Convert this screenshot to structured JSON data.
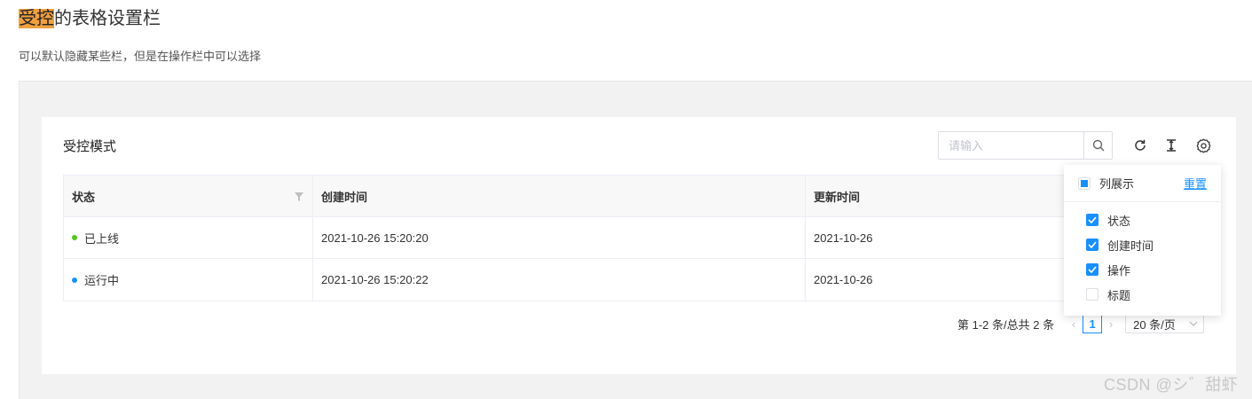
{
  "page": {
    "title_highlight": "受控",
    "title_rest": "的表格设置栏",
    "description": "可以默认隐藏某些栏，但是在操作栏中可以选择"
  },
  "card": {
    "title": "受控模式",
    "search_placeholder": "请输入",
    "icons": [
      "reload-icon",
      "column-height-icon",
      "setting-icon"
    ]
  },
  "table": {
    "headers": [
      "状态",
      "创建时间",
      "更新时间"
    ],
    "rows": [
      {
        "status": "已上线",
        "status_color": "#52c41a",
        "created": "2021-10-26 15:20:20",
        "updated": "2021-10-26"
      },
      {
        "status": "运行中",
        "status_color": "#1890ff",
        "created": "2021-10-26 15:20:22",
        "updated": "2021-10-26"
      }
    ]
  },
  "pagination": {
    "total_text": "第 1-2 条/总共 2 条",
    "current_page": "1",
    "page_size": "20 条/页"
  },
  "column_settings": {
    "header_label": "列展示",
    "reset_label": "重置",
    "items": [
      {
        "label": "状态",
        "checked": true
      },
      {
        "label": "创建时间",
        "checked": true
      },
      {
        "label": "操作",
        "checked": true
      },
      {
        "label": "标题",
        "checked": false
      }
    ]
  },
  "watermark": "CSDN @シ゛甜虾",
  "colors": {
    "accent": "#1890ff",
    "highlight": "#f0a040"
  }
}
